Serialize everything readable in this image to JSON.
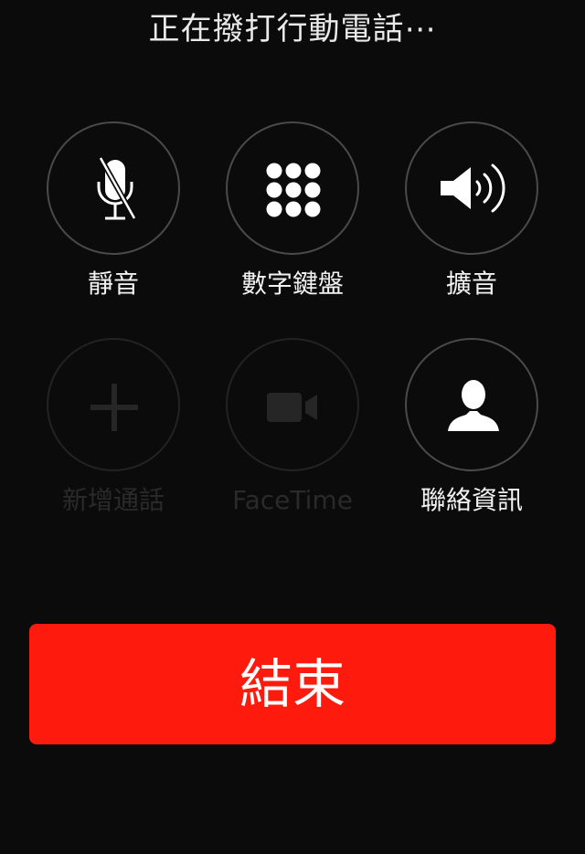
{
  "status": {
    "text": "正在撥打行動電話⋯"
  },
  "buttons": [
    {
      "label": "靜音",
      "icon": "microphone-muted-icon",
      "enabled": true
    },
    {
      "label": "數字鍵盤",
      "icon": "keypad-dots-icon",
      "enabled": true
    },
    {
      "label": "擴音",
      "icon": "speaker-icon",
      "enabled": true
    },
    {
      "label": "新增通話",
      "icon": "plus-icon",
      "enabled": false
    },
    {
      "label": "FaceTime",
      "icon": "video-camera-icon",
      "enabled": false
    },
    {
      "label": "聯絡資訊",
      "icon": "contact-person-icon",
      "enabled": true
    }
  ],
  "end_call": {
    "label": "結束"
  },
  "colors": {
    "background": "#0b0b0b",
    "end_button": "#fe1a0c",
    "circle_border": "#4a4a4a",
    "disabled": "#2a2a2a"
  }
}
